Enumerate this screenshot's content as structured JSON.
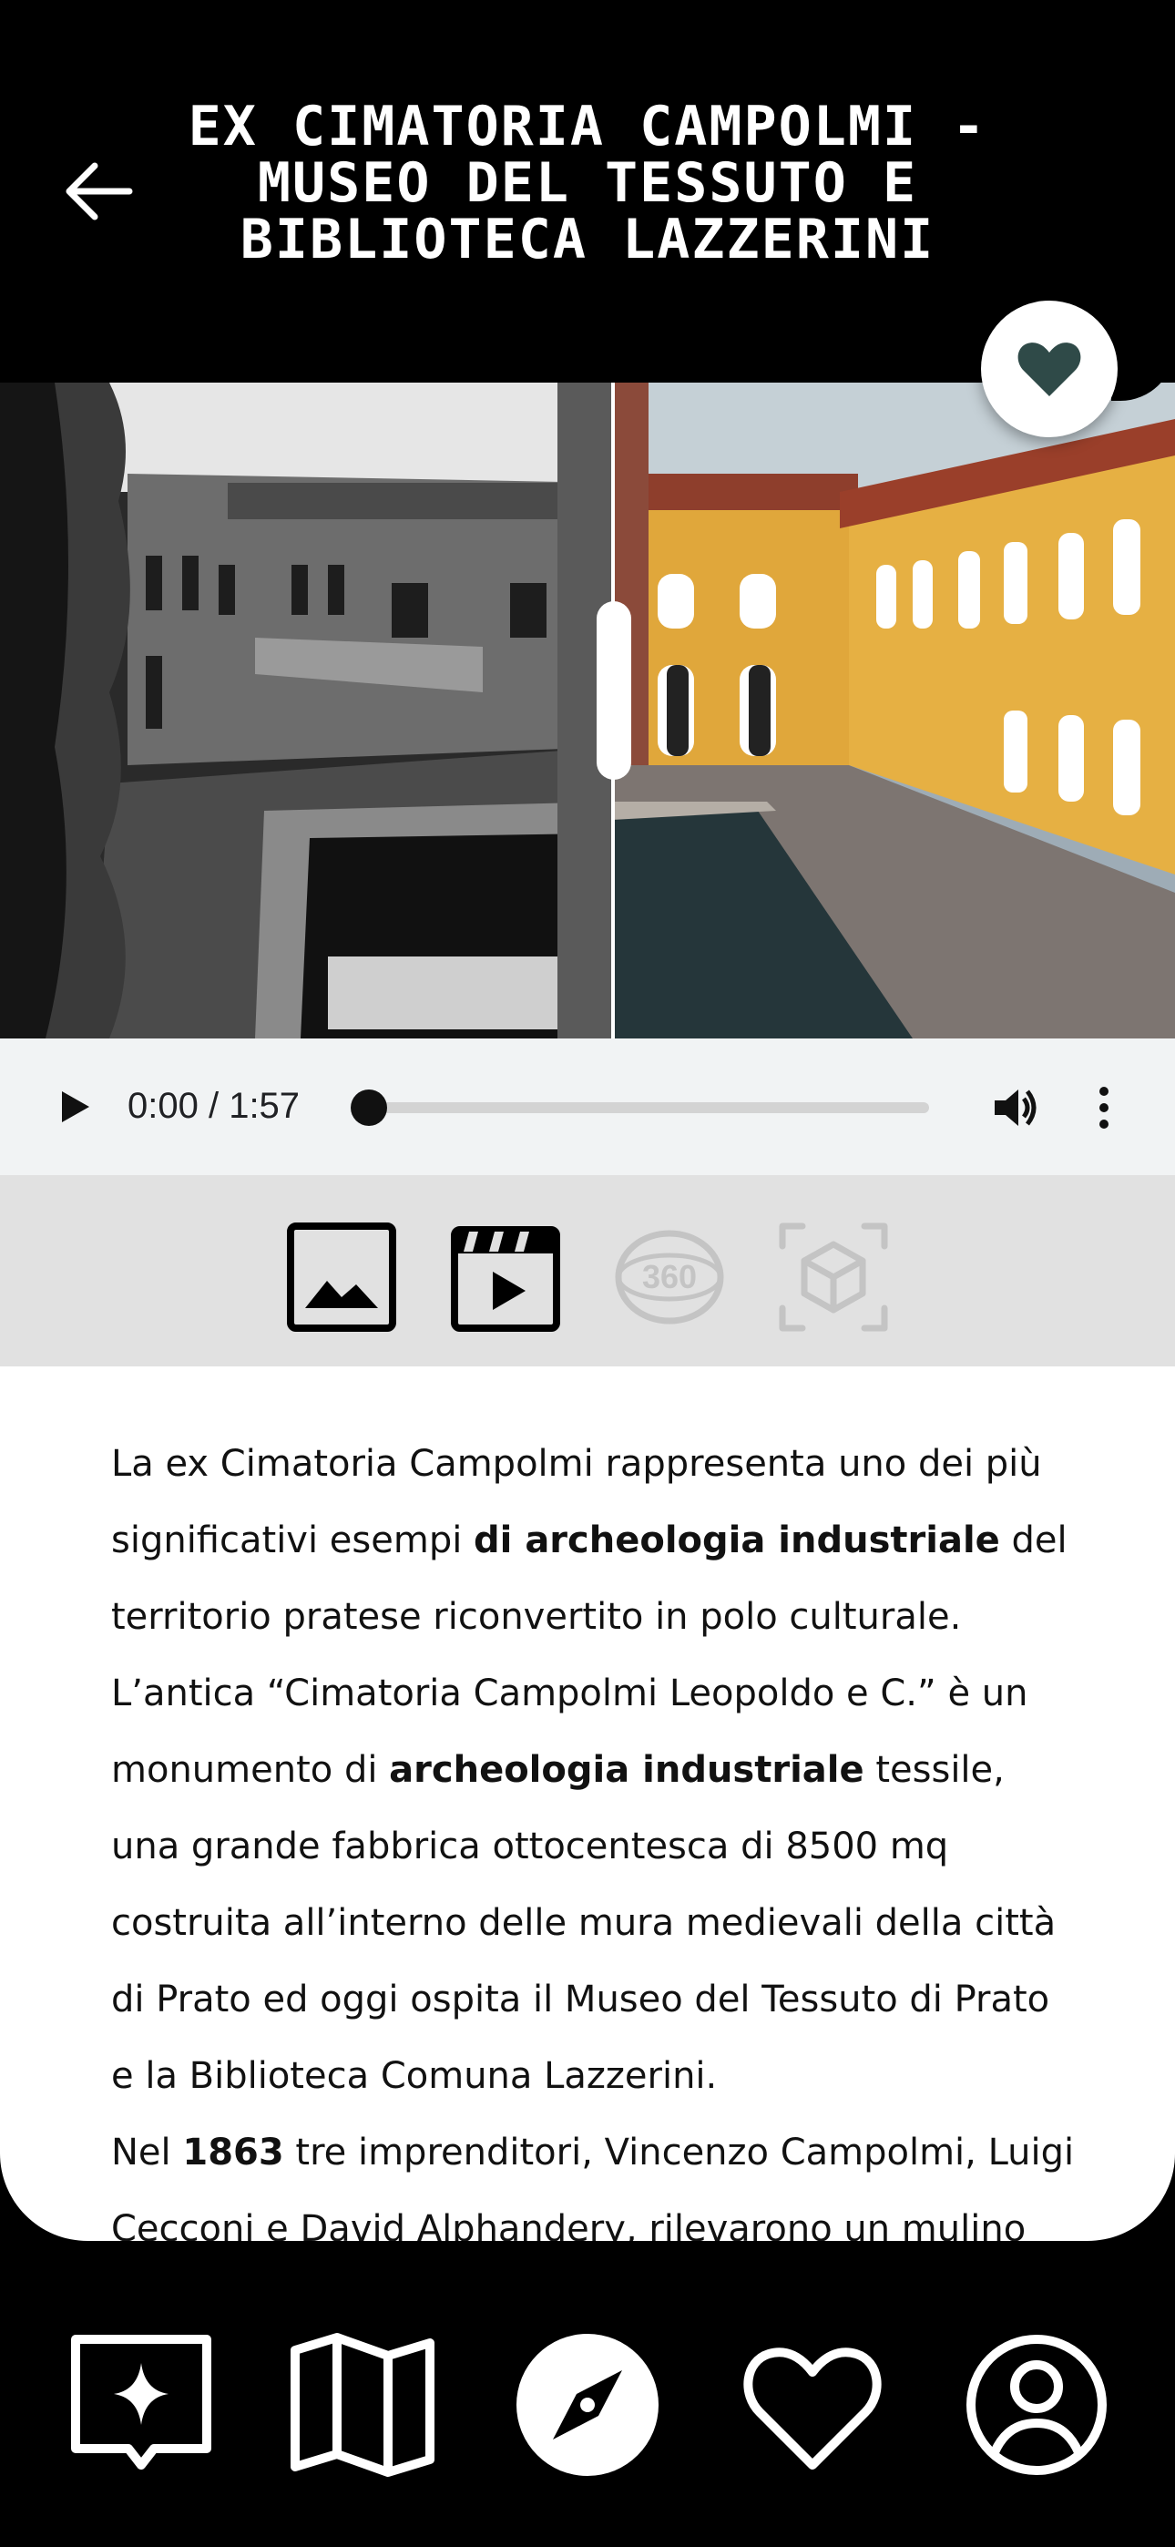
{
  "header": {
    "back_icon": "arrow-left-icon",
    "title": "EX CIMATORIA CAMPOLMI - MUSEO DEL TESSUTO E BIBLIOTECA LAZZERINI",
    "favorite_icon": "heart-icon"
  },
  "compare": {
    "before_label": "historic black and white photo",
    "after_label": "restored color photo",
    "slider_position": 0.52
  },
  "audio": {
    "play_icon": "play-icon",
    "time": "0:00 / 1:57",
    "progress": 0,
    "volume_icon": "volume-icon",
    "more_icon": "more-vertical-icon"
  },
  "media_tabs": [
    {
      "icon": "image-icon",
      "active": true
    },
    {
      "icon": "video-icon",
      "active": true
    },
    {
      "icon": "360-icon",
      "active": false
    },
    {
      "icon": "3d-cube-icon",
      "active": false
    }
  ],
  "description": {
    "p1_a": "La ex Cimatoria Campolmi rappresenta uno dei più significativi esempi ",
    "p1_b": "di archeologia industriale",
    "p1_c": " del territorio pratese riconvertito in polo culturale.",
    "p2_a": "L’antica “Cimatoria Campolmi Leopoldo e C.” è un monumento di ",
    "p2_b": "archeologia industriale",
    "p2_c": " tessile, una grande fabbrica ottocentesca di 8500 mq costruita all’interno delle mura medievali della città di Prato ed oggi ospita il Museo del Tessuto di Prato e la Biblioteca Comuna Lazzerini.",
    "p3_a": "Nel ",
    "p3_b": "1863",
    "p3_c": " tre imprenditori, Vincenzo Campolmi, Luigi Cecconi e David Alphandery, rilevarono un mulino"
  },
  "colors": {
    "accent": "#2f4a48",
    "background": "#000000",
    "media_bar": "#e1e1e1",
    "audio_bar": "#f1f3f4"
  },
  "nav": [
    {
      "icon": "sparkle-chat-icon"
    },
    {
      "icon": "map-icon"
    },
    {
      "icon": "compass-icon",
      "active": true
    },
    {
      "icon": "heart-outline-icon"
    },
    {
      "icon": "user-circle-icon"
    }
  ]
}
